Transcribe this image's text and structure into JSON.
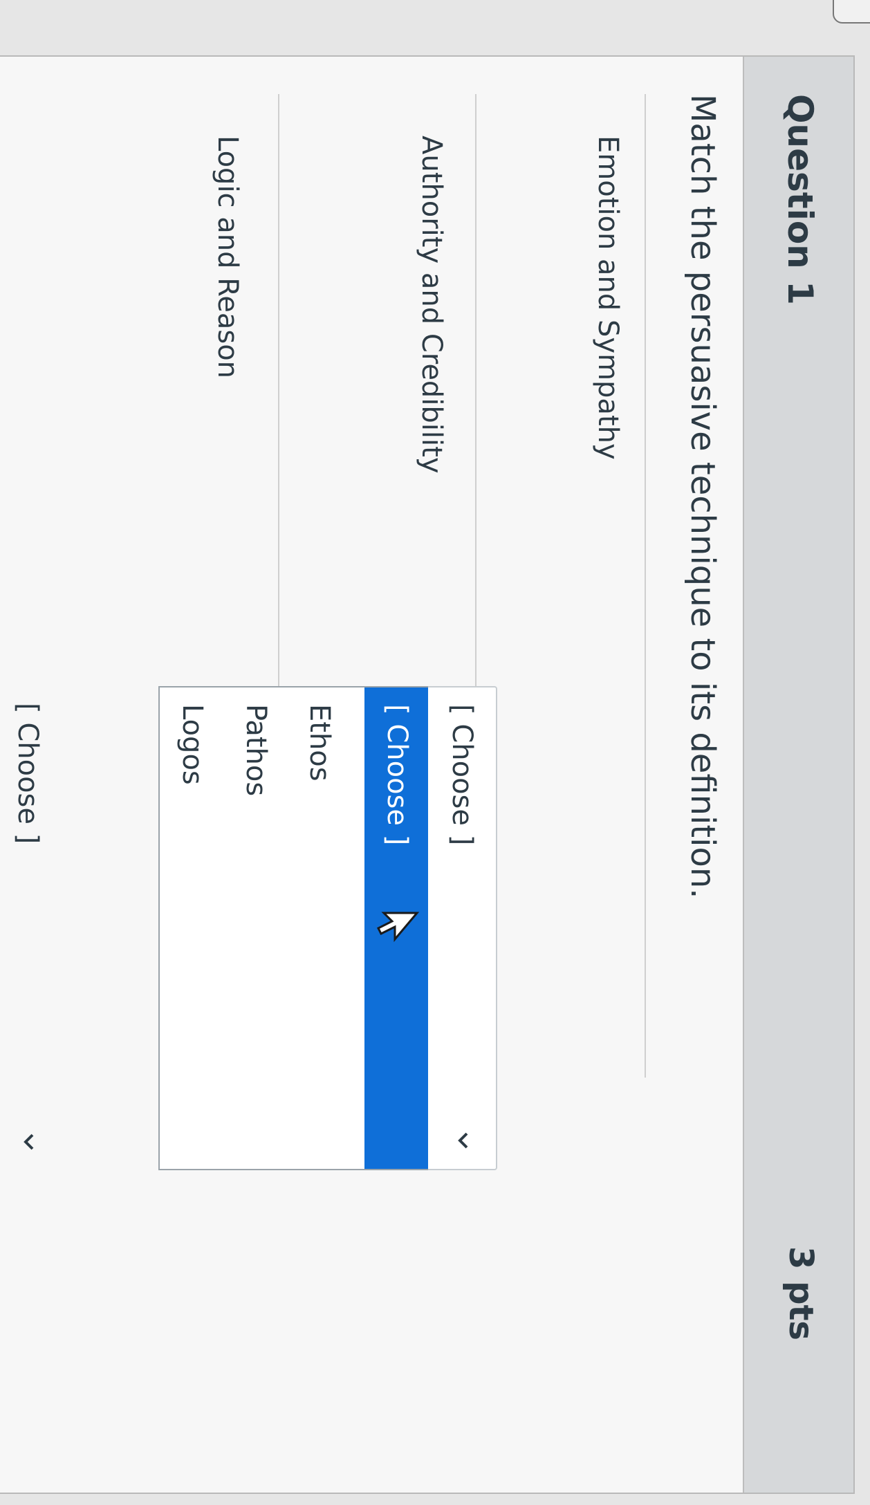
{
  "question": {
    "title": "Question 1",
    "points": "3 pts",
    "prompt": "Match the persuasive technique to its definition."
  },
  "rows": [
    {
      "label": "Emotion and Sympathy",
      "selected": "[ Choose ]"
    },
    {
      "label": "Authority and Credibility"
    },
    {
      "label": "Logic and Reason",
      "selected": "[ Choose ]"
    }
  ],
  "dropdown": {
    "options": [
      "[ Choose ]",
      "Ethos",
      "Pathos",
      "Logos"
    ],
    "highlighted_index": 0
  },
  "colors": {
    "highlight": "#0f6fd8",
    "text": "#2d3b45"
  },
  "icons": {
    "cursor": "arrow-cursor-icon",
    "chevron": "chevron-down-icon"
  }
}
